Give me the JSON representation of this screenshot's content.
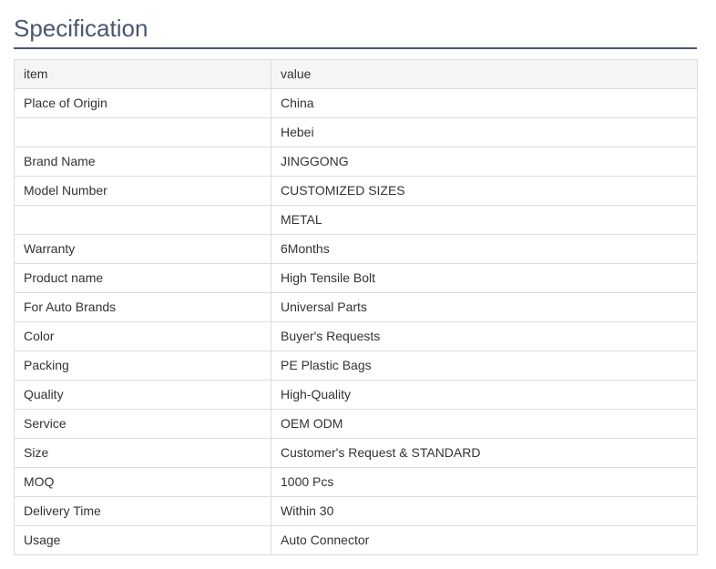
{
  "title": "Specification",
  "table": {
    "headers": [
      "item",
      "value"
    ],
    "rows": [
      [
        "Place of Origin",
        "China"
      ],
      [
        "",
        "Hebei"
      ],
      [
        "Brand Name",
        "JINGGONG"
      ],
      [
        "Model Number",
        "CUSTOMIZED SIZES"
      ],
      [
        "",
        "METAL"
      ],
      [
        "Warranty",
        "6Months"
      ],
      [
        "Product name",
        "High Tensile Bolt"
      ],
      [
        "For Auto Brands",
        "Universal Parts"
      ],
      [
        "Color",
        "Buyer's Requests"
      ],
      [
        "Packing",
        "PE Plastic Bags"
      ],
      [
        "Quality",
        "High-Quality"
      ],
      [
        "Service",
        "OEM ODM"
      ],
      [
        "Size",
        "Customer's Request & STANDARD"
      ],
      [
        "MOQ",
        "1000 Pcs"
      ],
      [
        "Delivery Time",
        "Within 30"
      ],
      [
        "Usage",
        "Auto Connector"
      ]
    ]
  }
}
